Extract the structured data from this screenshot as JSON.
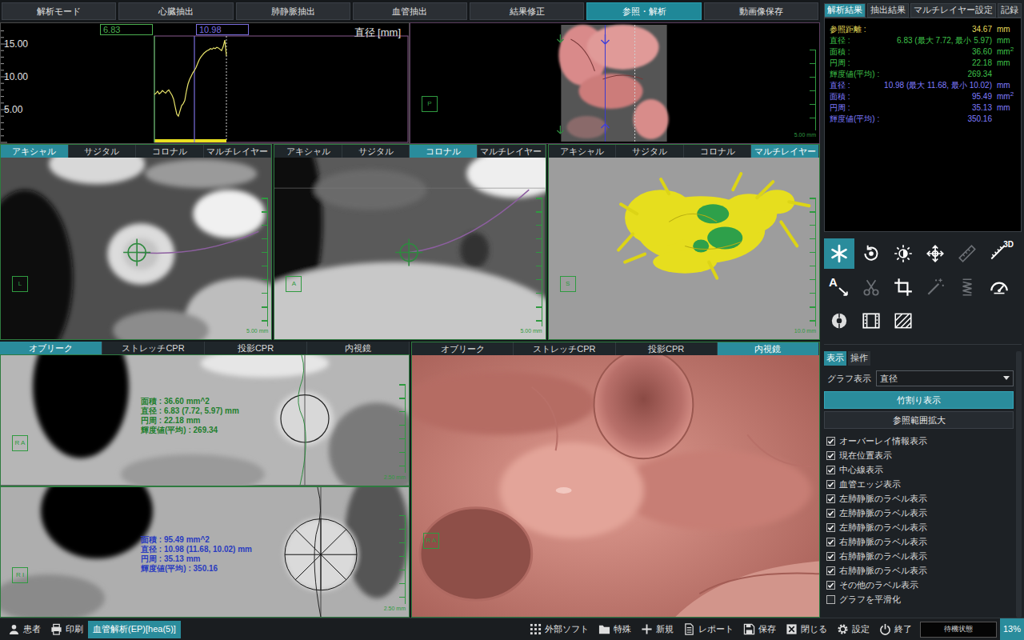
{
  "toolbar": {
    "tabs": [
      {
        "label": "解析モード",
        "selected": false
      },
      {
        "label": "心臓抽出",
        "selected": false
      },
      {
        "label": "肺静脈抽出",
        "selected": false
      },
      {
        "label": "血管抽出",
        "selected": false
      },
      {
        "label": "結果修正",
        "selected": false
      },
      {
        "label": "参照・解析",
        "selected": true
      },
      {
        "label": "動画像保存",
        "selected": false
      }
    ]
  },
  "graph": {
    "unit_label": "直径 [mm]",
    "y_ticks": [
      "15.00",
      "10.00",
      "5.00"
    ],
    "values": [
      7.3,
      7.5,
      7.8,
      7.4,
      7.6,
      7.9,
      7.7,
      7.5,
      7.8,
      8.0,
      7.6,
      7.2,
      6.6,
      5.4,
      4.3,
      4.0,
      4.8,
      5.6,
      5.9,
      6.4,
      7.8,
      8.9,
      9.6,
      10.1,
      10.6,
      10.98,
      11.4,
      12.0,
      12.6,
      13.0,
      13.3,
      13.6,
      13.8,
      14.0,
      14.1,
      14.3,
      14.2,
      14.4,
      14.3,
      14.5,
      14.4,
      14.2,
      14.0,
      14.6,
      15.6,
      13.2
    ],
    "markers": [
      {
        "label": "6.83",
        "index": 0,
        "color": "#4caf50"
      },
      {
        "label": "10.98",
        "index": 25,
        "color": "#7b6fe0"
      }
    ]
  },
  "reference_view": {
    "orient": "P",
    "scale": "5.00 mm"
  },
  "viewports": [
    {
      "kind": "axial",
      "orient": "L",
      "scale": "5.00 mm",
      "tabs": [
        {
          "label": "アキシャル",
          "selected": true
        },
        {
          "label": "サジタル",
          "selected": false
        },
        {
          "label": "コロナル",
          "selected": false
        },
        {
          "label": "マルチレイヤー",
          "selected": false
        }
      ]
    },
    {
      "kind": "coronal",
      "orient": "A",
      "scale": "5.00 mm",
      "tabs": [
        {
          "label": "アキシャル",
          "selected": false
        },
        {
          "label": "サジタル",
          "selected": false
        },
        {
          "label": "コロナル",
          "selected": true
        },
        {
          "label": "マルチレイヤー",
          "selected": false
        }
      ]
    },
    {
      "kind": "render3d",
      "orient": "S",
      "scale": "10.0 mm",
      "tabs": [
        {
          "label": "アキシャル",
          "selected": false
        },
        {
          "label": "サジタル",
          "selected": false
        },
        {
          "label": "コロナル",
          "selected": false
        },
        {
          "label": "マルチレイヤー",
          "selected": true
        }
      ]
    }
  ],
  "oblique": {
    "tabs": [
      {
        "label": "オブリーク",
        "selected": true
      },
      {
        "label": "ストレッチCPR",
        "selected": false
      },
      {
        "label": "投影CPR",
        "selected": false
      },
      {
        "label": "内視鏡",
        "selected": false
      }
    ],
    "views": [
      {
        "orient": "R A",
        "scale": "2.50 mm",
        "color": "#1f7f2e",
        "overlay": [
          "面積 : 36.60 mm^2",
          "直径 : 6.83 (7.72, 5.97) mm",
          "円周 : 22.18 mm",
          "輝度値(平均) : 269.34"
        ]
      },
      {
        "orient": "R I",
        "scale": "2.50 mm",
        "color": "#2a3cc0",
        "overlay": [
          "面積 : 95.49 mm^2",
          "直径 : 10.98 (11.68, 10.02) mm",
          "円周 : 35.13 mm",
          "輝度値(平均) : 350.16"
        ]
      }
    ]
  },
  "endoscope": {
    "orient": "R A",
    "tabs": [
      {
        "label": "オブリーク",
        "selected": false
      },
      {
        "label": "ストレッチCPR",
        "selected": false
      },
      {
        "label": "投影CPR",
        "selected": false
      },
      {
        "label": "内視鏡",
        "selected": true
      }
    ]
  },
  "sidebar": {
    "tabs": [
      {
        "label": "解析結果",
        "selected": true
      },
      {
        "label": "抽出結果",
        "selected": false
      },
      {
        "label": "マルチレイヤー設定",
        "selected": false
      },
      {
        "label": "記録",
        "selected": false
      }
    ],
    "results": [
      {
        "color": "#e6dc5a",
        "rows": [
          {
            "label": "参照距離 :",
            "value": "34.67",
            "unit": "mm"
          }
        ]
      },
      {
        "color": "#3fc24a",
        "rows": [
          {
            "label": "直径 :",
            "value": "6.83 (最大 7.72, 最小 5.97)",
            "unit": "mm"
          },
          {
            "label": "面積 :",
            "value": "36.60",
            "unit": "mm",
            "sup": "2"
          },
          {
            "label": "円周 :",
            "value": "22.18",
            "unit": "mm"
          },
          {
            "label": "輝度値(平均) :",
            "value": "269.34"
          }
        ]
      },
      {
        "color": "#7f7cff",
        "rows": [
          {
            "label": "直径 :",
            "value": "10.98 (最大 11.68, 最小 10.02)",
            "unit": "mm"
          },
          {
            "label": "面積 :",
            "value": "95.49",
            "unit": "mm",
            "sup": "2"
          },
          {
            "label": "円周 :",
            "value": "35.13",
            "unit": "mm"
          },
          {
            "label": "輝度値(平均) :",
            "value": "350.16"
          }
        ]
      }
    ],
    "tools": [
      {
        "kind": "asterisk",
        "selected": true,
        "disabled": false
      },
      {
        "kind": "rotate",
        "selected": false,
        "disabled": false
      },
      {
        "kind": "brightness",
        "selected": false,
        "disabled": false
      },
      {
        "kind": "pan",
        "selected": false,
        "disabled": false
      },
      {
        "kind": "ruler",
        "selected": false,
        "disabled": true
      },
      {
        "kind": "ruler3d",
        "selected": false,
        "disabled": false,
        "text": "3D"
      },
      {
        "kind": "annotate",
        "selected": false,
        "disabled": false,
        "text": "A"
      },
      {
        "kind": "cut",
        "selected": false,
        "disabled": true
      },
      {
        "kind": "crop",
        "selected": false,
        "disabled": false
      },
      {
        "kind": "wand",
        "selected": false,
        "disabled": true
      },
      {
        "kind": "spring",
        "selected": false,
        "disabled": true
      },
      {
        "kind": "gauge",
        "selected": false,
        "disabled": false
      },
      {
        "kind": "probe",
        "selected": false,
        "disabled": false
      },
      {
        "kind": "film",
        "selected": false,
        "disabled": false
      },
      {
        "kind": "hatch",
        "selected": false,
        "disabled": false
      }
    ],
    "panel_tabs": [
      {
        "label": "表示",
        "selected": true
      },
      {
        "label": "操作",
        "selected": false
      }
    ],
    "graph_select": {
      "label": "グラフ表示",
      "value": "直径"
    },
    "buttons": [
      {
        "label": "竹割り表示",
        "selected": true
      },
      {
        "label": "参照範囲拡大",
        "selected": false
      }
    ],
    "options": [
      {
        "label": "オーバーレイ情報表示",
        "checked": true
      },
      {
        "label": "現在位置表示",
        "checked": true
      },
      {
        "label": "中心線表示",
        "checked": true
      },
      {
        "label": "血管エッジ表示",
        "checked": true
      },
      {
        "label": "左肺静脈のラベル表示",
        "checked": true
      },
      {
        "label": "左肺静脈のラベル表示",
        "checked": true
      },
      {
        "label": "左肺静脈のラベル表示",
        "checked": true
      },
      {
        "label": "右肺静脈のラベル表示",
        "checked": true
      },
      {
        "label": "右肺静脈のラベル表示",
        "checked": true
      },
      {
        "label": "右肺静脈のラベル表示",
        "checked": true
      },
      {
        "label": "その他のラベル表示",
        "checked": true
      },
      {
        "label": "グラフを平滑化",
        "checked": false
      }
    ]
  },
  "status_bar": {
    "left": [
      {
        "label": "患者",
        "kind": "person",
        "selected": false
      },
      {
        "label": "印刷",
        "kind": "printer",
        "selected": false
      },
      {
        "label": "血管解析(EP)[hea(5)]",
        "kind": "task",
        "selected": true
      }
    ],
    "right": [
      {
        "label": "外部ソフト",
        "kind": "grid"
      },
      {
        "label": "特殊",
        "kind": "folder"
      },
      {
        "label": "新規",
        "kind": "plus"
      },
      {
        "label": "レポート",
        "kind": "doc"
      },
      {
        "label": "保存",
        "kind": "disk"
      },
      {
        "label": "閉じる",
        "kind": "close"
      },
      {
        "label": "設定",
        "kind": "gear"
      },
      {
        "label": "終了",
        "kind": "power"
      }
    ],
    "state": "待機状態",
    "zoom": "13%"
  }
}
